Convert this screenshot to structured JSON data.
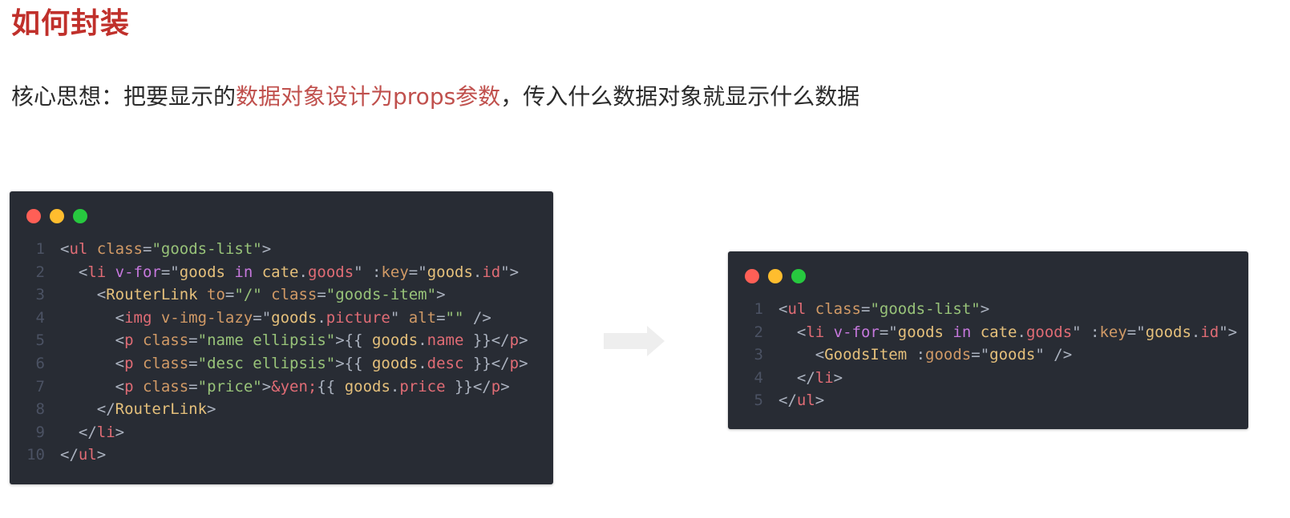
{
  "title": "如何封装",
  "subtitle": {
    "prefix": "核心思想：把要显示的",
    "highlight": "数据对象设计为props参数",
    "suffix": "，传入什么数据对象就显示什么数据"
  },
  "left_code": {
    "lines": [
      {
        "num": "1",
        "tokens": [
          {
            "t": "<",
            "c": "pun"
          },
          {
            "t": "ul",
            "c": "tag"
          },
          {
            "t": " class",
            "c": "attr"
          },
          {
            "t": "=",
            "c": "pun"
          },
          {
            "t": "\"goods-list\"",
            "c": "str"
          },
          {
            "t": ">",
            "c": "pun"
          }
        ]
      },
      {
        "num": "2",
        "tokens": [
          {
            "t": "  <",
            "c": "pun"
          },
          {
            "t": "li",
            "c": "tag"
          },
          {
            "t": " v-for",
            "c": "kw"
          },
          {
            "t": "=\"",
            "c": "pun"
          },
          {
            "t": "goods",
            "c": "var"
          },
          {
            "t": " in ",
            "c": "kw"
          },
          {
            "t": "cate",
            "c": "var"
          },
          {
            "t": ".",
            "c": "pun"
          },
          {
            "t": "goods",
            "c": "tag"
          },
          {
            "t": "\" :",
            "c": "pun"
          },
          {
            "t": "key",
            "c": "attr"
          },
          {
            "t": "=\"",
            "c": "pun"
          },
          {
            "t": "goods",
            "c": "var"
          },
          {
            "t": ".",
            "c": "pun"
          },
          {
            "t": "id",
            "c": "tag"
          },
          {
            "t": "\">",
            "c": "pun"
          }
        ]
      },
      {
        "num": "3",
        "tokens": [
          {
            "t": "    <",
            "c": "pun"
          },
          {
            "t": "RouterLink",
            "c": "comp"
          },
          {
            "t": " to",
            "c": "attr"
          },
          {
            "t": "=",
            "c": "pun"
          },
          {
            "t": "\"/\"",
            "c": "str"
          },
          {
            "t": " class",
            "c": "attr"
          },
          {
            "t": "=",
            "c": "pun"
          },
          {
            "t": "\"goods-item\"",
            "c": "str"
          },
          {
            "t": ">",
            "c": "pun"
          }
        ]
      },
      {
        "num": "4",
        "tokens": [
          {
            "t": "      <",
            "c": "pun"
          },
          {
            "t": "img",
            "c": "tag"
          },
          {
            "t": " v-img-lazy",
            "c": "attr"
          },
          {
            "t": "=\"",
            "c": "pun"
          },
          {
            "t": "goods",
            "c": "var"
          },
          {
            "t": ".",
            "c": "pun"
          },
          {
            "t": "picture",
            "c": "tag"
          },
          {
            "t": "\"",
            "c": "pun"
          },
          {
            "t": " alt",
            "c": "attr"
          },
          {
            "t": "=",
            "c": "pun"
          },
          {
            "t": "\"\"",
            "c": "str"
          },
          {
            "t": " />",
            "c": "pun"
          }
        ]
      },
      {
        "num": "5",
        "tokens": [
          {
            "t": "      <",
            "c": "pun"
          },
          {
            "t": "p",
            "c": "tag"
          },
          {
            "t": " class",
            "c": "attr"
          },
          {
            "t": "=",
            "c": "pun"
          },
          {
            "t": "\"name ellipsis\"",
            "c": "str"
          },
          {
            "t": ">{{ ",
            "c": "pun"
          },
          {
            "t": "goods",
            "c": "var"
          },
          {
            "t": ".",
            "c": "pun"
          },
          {
            "t": "name",
            "c": "tag"
          },
          {
            "t": " }}</",
            "c": "pun"
          },
          {
            "t": "p",
            "c": "tag"
          },
          {
            "t": ">",
            "c": "pun"
          }
        ]
      },
      {
        "num": "6",
        "tokens": [
          {
            "t": "      <",
            "c": "pun"
          },
          {
            "t": "p",
            "c": "tag"
          },
          {
            "t": " class",
            "c": "attr"
          },
          {
            "t": "=",
            "c": "pun"
          },
          {
            "t": "\"desc ellipsis\"",
            "c": "str"
          },
          {
            "t": ">{{ ",
            "c": "pun"
          },
          {
            "t": "goods",
            "c": "var"
          },
          {
            "t": ".",
            "c": "pun"
          },
          {
            "t": "desc",
            "c": "tag"
          },
          {
            "t": " }}</",
            "c": "pun"
          },
          {
            "t": "p",
            "c": "tag"
          },
          {
            "t": ">",
            "c": "pun"
          }
        ]
      },
      {
        "num": "7",
        "tokens": [
          {
            "t": "      <",
            "c": "pun"
          },
          {
            "t": "p",
            "c": "tag"
          },
          {
            "t": " class",
            "c": "attr"
          },
          {
            "t": "=",
            "c": "pun"
          },
          {
            "t": "\"price\"",
            "c": "str"
          },
          {
            "t": ">",
            "c": "pun"
          },
          {
            "t": "&yen;",
            "c": "tag"
          },
          {
            "t": "{{ ",
            "c": "pun"
          },
          {
            "t": "goods",
            "c": "var"
          },
          {
            "t": ".",
            "c": "pun"
          },
          {
            "t": "price",
            "c": "tag"
          },
          {
            "t": " }}</",
            "c": "pun"
          },
          {
            "t": "p",
            "c": "tag"
          },
          {
            "t": ">",
            "c": "pun"
          }
        ]
      },
      {
        "num": "8",
        "tokens": [
          {
            "t": "    </",
            "c": "pun"
          },
          {
            "t": "RouterLink",
            "c": "comp"
          },
          {
            "t": ">",
            "c": "pun"
          }
        ]
      },
      {
        "num": "9",
        "tokens": [
          {
            "t": "  </",
            "c": "pun"
          },
          {
            "t": "li",
            "c": "tag"
          },
          {
            "t": ">",
            "c": "pun"
          }
        ]
      },
      {
        "num": "10",
        "tokens": [
          {
            "t": "</",
            "c": "pun"
          },
          {
            "t": "ul",
            "c": "tag"
          },
          {
            "t": ">",
            "c": "pun"
          }
        ]
      }
    ]
  },
  "right_code": {
    "lines": [
      {
        "num": "1",
        "tokens": [
          {
            "t": "<",
            "c": "pun"
          },
          {
            "t": "ul",
            "c": "tag"
          },
          {
            "t": " class",
            "c": "attr"
          },
          {
            "t": "=",
            "c": "pun"
          },
          {
            "t": "\"goods-list\"",
            "c": "str"
          },
          {
            "t": ">",
            "c": "pun"
          }
        ]
      },
      {
        "num": "2",
        "tokens": [
          {
            "t": "  <",
            "c": "pun"
          },
          {
            "t": "li",
            "c": "tag"
          },
          {
            "t": " v-for",
            "c": "kw"
          },
          {
            "t": "=\"",
            "c": "pun"
          },
          {
            "t": "goods",
            "c": "var"
          },
          {
            "t": " in ",
            "c": "kw"
          },
          {
            "t": "cate",
            "c": "var"
          },
          {
            "t": ".",
            "c": "pun"
          },
          {
            "t": "goods",
            "c": "tag"
          },
          {
            "t": "\" :",
            "c": "pun"
          },
          {
            "t": "key",
            "c": "attr"
          },
          {
            "t": "=\"",
            "c": "pun"
          },
          {
            "t": "goods",
            "c": "var"
          },
          {
            "t": ".",
            "c": "pun"
          },
          {
            "t": "id",
            "c": "tag"
          },
          {
            "t": "\">",
            "c": "pun"
          }
        ]
      },
      {
        "num": "3",
        "tokens": [
          {
            "t": "    <",
            "c": "pun"
          },
          {
            "t": "GoodsItem",
            "c": "comp"
          },
          {
            "t": " :",
            "c": "pun"
          },
          {
            "t": "goods",
            "c": "attr"
          },
          {
            "t": "=",
            "c": "pun"
          },
          {
            "t": "\"",
            "c": "pun"
          },
          {
            "t": "goods",
            "c": "var"
          },
          {
            "t": "\"",
            "c": "pun"
          },
          {
            "t": " />",
            "c": "pun"
          }
        ]
      },
      {
        "num": "4",
        "tokens": [
          {
            "t": "  </",
            "c": "pun"
          },
          {
            "t": "li",
            "c": "tag"
          },
          {
            "t": ">",
            "c": "pun"
          }
        ]
      },
      {
        "num": "5",
        "tokens": [
          {
            "t": "</",
            "c": "pun"
          },
          {
            "t": "ul",
            "c": "tag"
          },
          {
            "t": ">",
            "c": "pun"
          }
        ]
      }
    ]
  },
  "colors": {
    "title": "#c0302b",
    "highlight": "#c0504d",
    "code_bg": "#282c34",
    "dot_red": "#ff5f56",
    "dot_yellow": "#ffbd2e",
    "dot_green": "#27c93f",
    "arrow": "#eeeeee"
  },
  "icons": {
    "arrow": "right-arrow-icon"
  }
}
